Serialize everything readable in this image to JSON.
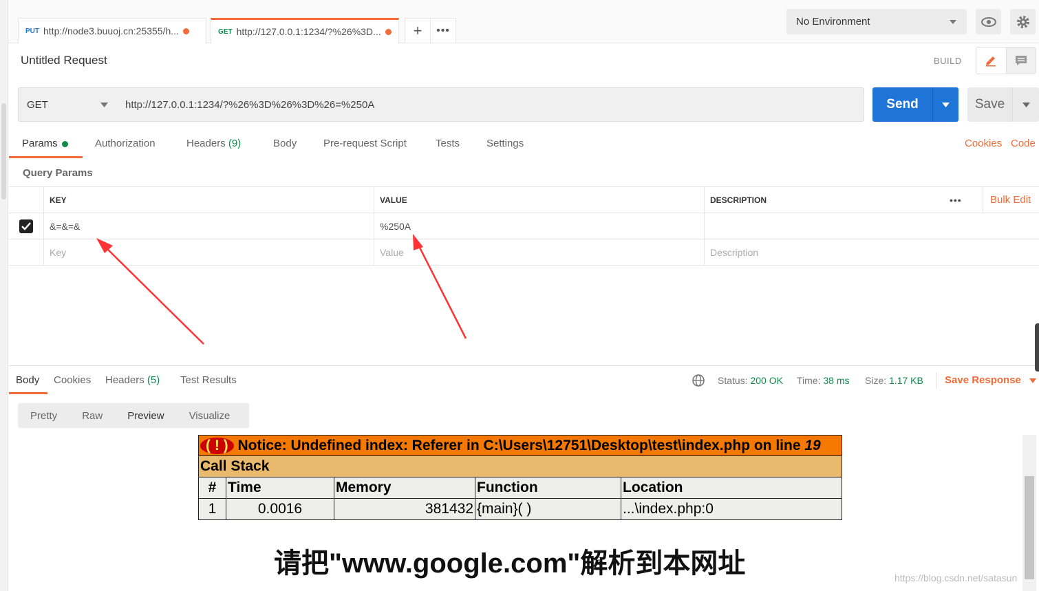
{
  "tabs": [
    {
      "method": "PUT",
      "url": "http://node3.buuoj.cn:25355/h..."
    },
    {
      "method": "GET",
      "url": "http://127.0.0.1:1234/?%26%3D..."
    }
  ],
  "environment": {
    "selected": "No Environment"
  },
  "request": {
    "title": "Untitled Request",
    "mode_label": "BUILD",
    "method": "GET",
    "url": "http://127.0.0.1:1234/?%26%3D%26%3D%26=%250A",
    "send_label": "Send",
    "save_label": "Save"
  },
  "request_tabs": [
    {
      "label": "Params",
      "count": ""
    },
    {
      "label": "Authorization",
      "count": ""
    },
    {
      "label": "Headers",
      "count": "(9)"
    },
    {
      "label": "Body",
      "count": ""
    },
    {
      "label": "Pre-request Script",
      "count": ""
    },
    {
      "label": "Tests",
      "count": ""
    },
    {
      "label": "Settings",
      "count": ""
    }
  ],
  "links": {
    "cookies": "Cookies",
    "code": "Code",
    "bulk_edit": "Bulk Edit"
  },
  "query_params": {
    "title": "Query Params",
    "headers": {
      "key": "KEY",
      "value": "VALUE",
      "description": "DESCRIPTION"
    },
    "rows": [
      {
        "key": "&=&=&",
        "value": "%250A",
        "description": "",
        "checked": true
      }
    ],
    "placeholders": {
      "key": "Key",
      "value": "Value",
      "description": "Description"
    }
  },
  "response": {
    "tabs": [
      {
        "label": "Body",
        "count": ""
      },
      {
        "label": "Cookies",
        "count": ""
      },
      {
        "label": "Headers",
        "count": "(5)"
      },
      {
        "label": "Test Results",
        "count": ""
      }
    ],
    "status_label": "Status:",
    "status_value": "200 OK",
    "time_label": "Time:",
    "time_value": "38 ms",
    "size_label": "Size:",
    "size_value": "1.17 KB",
    "save_response": "Save Response",
    "view_modes": [
      "Pretty",
      "Raw",
      "Preview",
      "Visualize"
    ]
  },
  "preview": {
    "bang": "( ! )",
    "notice": "Notice: Undefined index: Referer in C:\\Users\\12751\\Desktop\\test\\index.php on line",
    "line": "19",
    "call_stack": "Call Stack",
    "cols": [
      "#",
      "Time",
      "Memory",
      "Function",
      "Location"
    ],
    "row": [
      "1",
      "0.0016",
      "381432",
      "{main}( )",
      "...\\index.php:0"
    ],
    "big_text": "请把\"www.google.com\"解析到本网址"
  },
  "watermark": "https://blog.csdn.net/satasun"
}
